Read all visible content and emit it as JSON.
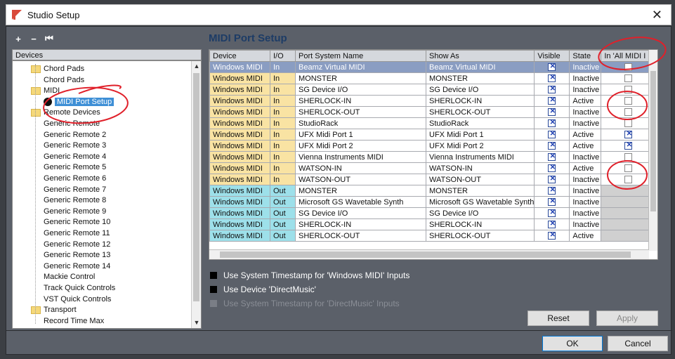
{
  "window": {
    "title": "Studio Setup",
    "close": "✕"
  },
  "toolbar": {
    "add": "+",
    "remove": "−",
    "reset": "⏮"
  },
  "tree": {
    "header": "Devices",
    "items": [
      {
        "label": "Chord Pads",
        "folder": true,
        "level": 1
      },
      {
        "label": "Chord Pads",
        "folder": false,
        "level": 2
      },
      {
        "label": "MIDI",
        "folder": true,
        "level": 1
      },
      {
        "label": "MIDI Port Setup",
        "folder": false,
        "level": 2,
        "selected": true
      },
      {
        "label": "Remote Devices",
        "folder": true,
        "level": 1
      },
      {
        "label": "Generic Remote",
        "level": 2
      },
      {
        "label": "Generic Remote 2",
        "level": 2
      },
      {
        "label": "Generic Remote 3",
        "level": 2
      },
      {
        "label": "Generic Remote 4",
        "level": 2
      },
      {
        "label": "Generic Remote 5",
        "level": 2
      },
      {
        "label": "Generic Remote 6",
        "level": 2
      },
      {
        "label": "Generic Remote 7",
        "level": 2
      },
      {
        "label": "Generic Remote 8",
        "level": 2
      },
      {
        "label": "Generic Remote 9",
        "level": 2
      },
      {
        "label": "Generic Remote 10",
        "level": 2
      },
      {
        "label": "Generic Remote 11",
        "level": 2
      },
      {
        "label": "Generic Remote 12",
        "level": 2
      },
      {
        "label": "Generic Remote 13",
        "level": 2
      },
      {
        "label": "Generic Remote 14",
        "level": 2
      },
      {
        "label": "Mackie Control",
        "level": 2
      },
      {
        "label": "Track Quick Controls",
        "level": 2
      },
      {
        "label": "VST Quick Controls",
        "level": 2
      },
      {
        "label": "Transport",
        "folder": true,
        "level": 1
      },
      {
        "label": "Record Time Max",
        "level": 2
      }
    ]
  },
  "main": {
    "title": "MIDI Port Setup",
    "columns": [
      "Device",
      "I/O",
      "Port System Name",
      "Show As",
      "Visible",
      "State",
      "In 'All MIDI I"
    ],
    "rows": [
      {
        "device": "Windows MIDI",
        "io": "In",
        "port": "Beamz Virtual MIDI",
        "show": "Beamz Virtual MIDI",
        "visible": true,
        "state": "Inactive",
        "all": false,
        "hl": true
      },
      {
        "device": "Windows MIDI",
        "io": "In",
        "port": "MONSTER",
        "show": "MONSTER",
        "visible": true,
        "state": "Inactive",
        "all": false
      },
      {
        "device": "Windows MIDI",
        "io": "In",
        "port": "SG Device I/O",
        "show": "SG Device I/O",
        "visible": true,
        "state": "Inactive",
        "all": false
      },
      {
        "device": "Windows MIDI",
        "io": "In",
        "port": "SHERLOCK-IN",
        "show": "SHERLOCK-IN",
        "visible": true,
        "state": "Active",
        "all": false
      },
      {
        "device": "Windows MIDI",
        "io": "In",
        "port": "SHERLOCK-OUT",
        "show": "SHERLOCK-OUT",
        "visible": true,
        "state": "Inactive",
        "all": false
      },
      {
        "device": "Windows MIDI",
        "io": "In",
        "port": "StudioRack",
        "show": "StudioRack",
        "visible": true,
        "state": "Inactive",
        "all": false
      },
      {
        "device": "Windows MIDI",
        "io": "In",
        "port": "UFX Midi Port 1",
        "show": "UFX Midi Port 1",
        "visible": true,
        "state": "Active",
        "all": true
      },
      {
        "device": "Windows MIDI",
        "io": "In",
        "port": "UFX Midi Port 2",
        "show": "UFX Midi Port 2",
        "visible": true,
        "state": "Active",
        "all": true
      },
      {
        "device": "Windows MIDI",
        "io": "In",
        "port": "Vienna Instruments MIDI",
        "show": "Vienna Instruments MIDI",
        "visible": true,
        "state": "Inactive",
        "all": false
      },
      {
        "device": "Windows MIDI",
        "io": "In",
        "port": "WATSON-IN",
        "show": "WATSON-IN",
        "visible": true,
        "state": "Active",
        "all": false
      },
      {
        "device": "Windows MIDI",
        "io": "In",
        "port": "WATSON-OUT",
        "show": "WATSON-OUT",
        "visible": true,
        "state": "Inactive",
        "all": false
      },
      {
        "device": "Windows MIDI",
        "io": "Out",
        "port": "MONSTER",
        "show": "MONSTER",
        "visible": true,
        "state": "Inactive",
        "all": null
      },
      {
        "device": "Windows MIDI",
        "io": "Out",
        "port": "Microsoft GS Wavetable Synth",
        "show": "Microsoft GS Wavetable Synth",
        "visible": true,
        "state": "Inactive",
        "all": null
      },
      {
        "device": "Windows MIDI",
        "io": "Out",
        "port": "SG Device I/O",
        "show": "SG Device I/O",
        "visible": true,
        "state": "Inactive",
        "all": null
      },
      {
        "device": "Windows MIDI",
        "io": "Out",
        "port": "SHERLOCK-IN",
        "show": "SHERLOCK-IN",
        "visible": true,
        "state": "Inactive",
        "all": null
      },
      {
        "device": "Windows MIDI",
        "io": "Out",
        "port": "SHERLOCK-OUT",
        "show": "SHERLOCK-OUT",
        "visible": true,
        "state": "Active",
        "all": null
      }
    ],
    "options": [
      {
        "label": "Use System Timestamp for 'Windows MIDI' Inputs",
        "enabled": true
      },
      {
        "label": "Use Device 'DirectMusic'",
        "enabled": true
      },
      {
        "label": "Use System Timestamp for 'DirectMusic' Inputs",
        "enabled": false
      }
    ],
    "reset_label": "Reset",
    "apply_label": "Apply"
  },
  "footer": {
    "ok_label": "OK",
    "cancel_label": "Cancel"
  },
  "colors": {
    "in_row": "#f9e3a3",
    "out_row": "#9de0ea",
    "highlight": "#8a9dc2",
    "annotation": "#e0202a"
  }
}
